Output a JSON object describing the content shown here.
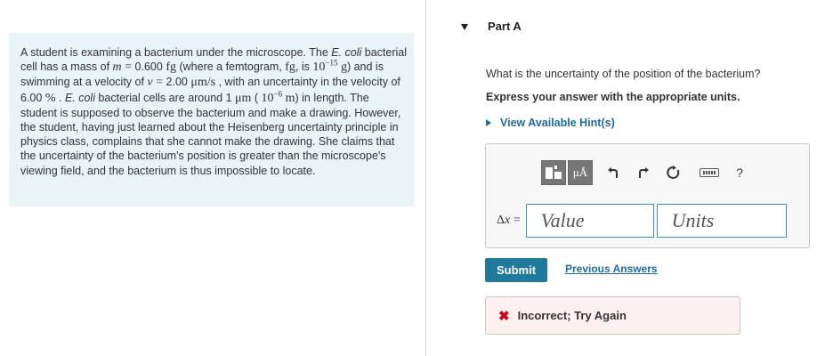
{
  "problem": {
    "t1": "A student is examining a bacterium under the microscope. The ",
    "t2": "E. coli",
    "t3": " bacterial cell has a mass of ",
    "m_sym": "m",
    "m_eq": " = ",
    "m_val": "0.600",
    "m_unit": " fg",
    "t4": " (where a femtogram, ",
    "fg": "fg",
    "t5": ", is ",
    "ten1": "10",
    "exp1": "−15",
    "g_unit": " g",
    "t6": ") and is swimming at a velocity of ",
    "v_sym": "v",
    "v_eq": " = ",
    "v_val": "2.00",
    "v_unit": " μm/s",
    "t7": " , with an uncertainty in the velocity of ",
    "unc_val": "6.00",
    "pct": " %",
    "t8": " . ",
    "t9": "E. coli",
    "t10": " bacterial cells are around 1 ",
    "um": "μm",
    "t11": " ( ",
    "ten2": "10",
    "exp2": "−6",
    "m_unit2": " m",
    "t12": ") in length. The student is supposed to observe the bacterium and make a drawing. However, the student, having just learned about the Heisenberg uncertainty principle in physics class, complains that she cannot make the drawing. She claims that the uncertainty of the bacterium's position is greater than the microscope's viewing field, and the bacterium is thus impossible to locate."
  },
  "part": {
    "title": "Part A",
    "question": "What is the uncertainty of the position of the bacterium?",
    "instruction": "Express your answer with the appropriate units.",
    "hints_label": "View Available Hint(s)"
  },
  "toolbar": {
    "units_label": "μÅ",
    "help_label": "?",
    "icons": [
      "templates-icon",
      "units-icon",
      "undo-icon",
      "redo-icon",
      "reset-icon",
      "keyboard-icon",
      "help-icon"
    ]
  },
  "answer": {
    "label_delta": "Δ",
    "label_x": "x",
    "label_eq": " =",
    "value_placeholder": "Value",
    "units_placeholder": "Units"
  },
  "actions": {
    "submit_label": "Submit",
    "previous_answers_label": "Previous Answers"
  },
  "feedback": {
    "icon": "✖",
    "text": "Incorrect; Try Again"
  },
  "colors": {
    "accent": "#1f7a9b",
    "link": "#1f6b9a",
    "error": "#d0021b",
    "problem_bg": "#e8f4f5"
  }
}
